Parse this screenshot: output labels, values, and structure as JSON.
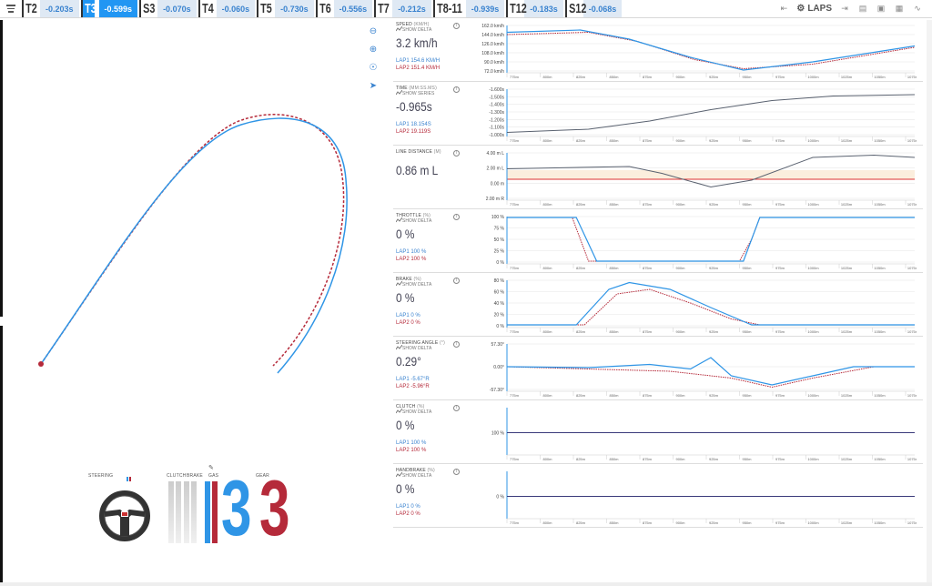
{
  "topbar": {
    "segments": [
      {
        "name": "T2",
        "delta": "-0.203s",
        "active": false
      },
      {
        "name": "T3",
        "delta": "-0.599s",
        "active": true
      },
      {
        "name": "S3",
        "delta": "-0.070s",
        "active": false
      },
      {
        "name": "T4",
        "delta": "-0.060s",
        "active": false
      },
      {
        "name": "T5",
        "delta": "-0.730s",
        "active": false
      },
      {
        "name": "T6",
        "delta": "-0.556s",
        "active": false
      },
      {
        "name": "T7",
        "delta": "-0.212s",
        "active": false
      },
      {
        "name": "T8-11",
        "delta": "-0.939s",
        "active": false
      },
      {
        "name": "T12",
        "delta": "-0.183s",
        "active": false
      },
      {
        "name": "S12",
        "delta": "-0.068s",
        "active": false
      }
    ],
    "laps_label": "LAPS",
    "icons": [
      "prev-lap-icon",
      "gear-icon",
      "next-lap-icon",
      "car-icon",
      "car-front-icon",
      "book-icon",
      "graph-icon"
    ]
  },
  "colors": {
    "lap1": "#2f95e6",
    "lap2": "#b52a3a",
    "accent": "#2196f3"
  },
  "bottom": {
    "steering_label": "STEERING",
    "clutch_label": "CLUTCH",
    "brake_label": "BRAKE",
    "gas_label": "GAS",
    "gear_label": "GEAR",
    "gear_lap1": "3",
    "gear_lap2": "3"
  },
  "x_ticks": [
    "775m",
    "800m",
    "825m",
    "850m",
    "875m",
    "900m",
    "925m",
    "950m",
    "975m",
    "1000m",
    "1025m",
    "1050m",
    "1075m"
  ],
  "panels": [
    {
      "title": "SPEED",
      "unit": "(KM/H)",
      "sub": "SHOW DELTA",
      "value": "3.2 km/h",
      "lap1": "LAP1 154.6 KM/H",
      "lap2": "LAP2 151.4 KM/H",
      "yticks": [
        "162.0 km/h",
        "144.0 km/h",
        "126.0 km/h",
        "108.0 km/h",
        "90.0 km/h",
        "72.0 km/h"
      ]
    },
    {
      "title": "TIME",
      "unit": "(MM:SS.MS)",
      "sub": "SHOW SERIES",
      "value": "-0.965s",
      "lap1": "LAP1 18.154S",
      "lap2": "LAP2 19.119S",
      "yticks": [
        "-1.600s",
        "-1.500s",
        "-1.400s",
        "-1.300s",
        "-1.200s",
        "-1.100s",
        "-1.000s"
      ]
    },
    {
      "title": "LINE DISTANCE",
      "unit": "(M)",
      "sub": "",
      "value": "0.86 m L",
      "lap1": "",
      "lap2": "",
      "yticks": [
        "4.00 m L",
        "2.00 m L",
        "0.00 m",
        "2.00 m R"
      ]
    },
    {
      "title": "THROTTLE",
      "unit": "(%)",
      "sub": "SHOW DELTA",
      "value": "0 %",
      "lap1": "LAP1 100 %",
      "lap2": "LAP2 100 %",
      "yticks": [
        "100 %",
        "75 %",
        "50 %",
        "25 %",
        "0 %"
      ]
    },
    {
      "title": "BRAKE",
      "unit": "(%)",
      "sub": "SHOW DELTA",
      "value": "0 %",
      "lap1": "LAP1 0 %",
      "lap2": "LAP2 0 %",
      "yticks": [
        "80 %",
        "60 %",
        "40 %",
        "20 %",
        "0 %"
      ]
    },
    {
      "title": "STEERING ANGLE",
      "unit": "(°)",
      "sub": "SHOW DELTA",
      "value": "0.29°",
      "lap1": "LAP1 -5.67°R",
      "lap2": "LAP2 -5.96°R",
      "yticks": [
        "57.30°",
        "0.00°",
        "-57.30°"
      ]
    },
    {
      "title": "CLUTCH",
      "unit": "(%)",
      "sub": "SHOW DELTA",
      "value": "0 %",
      "lap1": "LAP1 100 %",
      "lap2": "LAP2 100 %",
      "yticks": [
        "100 %"
      ]
    },
    {
      "title": "HANDBRAKE",
      "unit": "(%)",
      "sub": "SHOW DELTA",
      "value": "0 %",
      "lap1": "LAP1 0 %",
      "lap2": "LAP2 0 %",
      "yticks": [
        "0 %"
      ]
    }
  ]
}
